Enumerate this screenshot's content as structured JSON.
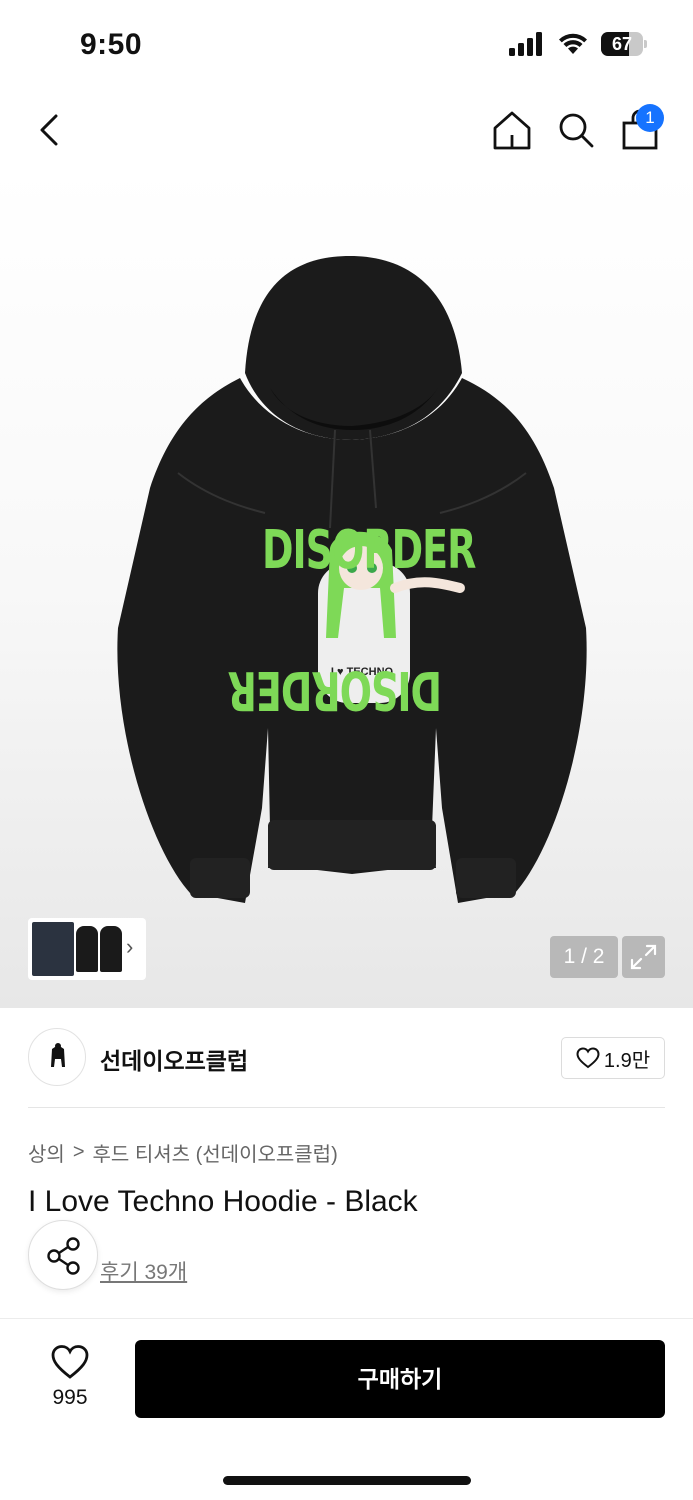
{
  "status_bar": {
    "time": "9:50",
    "battery": "67",
    "battery_level": 0.67
  },
  "nav": {
    "cart_count": "1"
  },
  "gallery": {
    "pager": "1 / 2",
    "hoodie_print_text": "DISORDER",
    "hoodie_print_small": "I ♥ TECHNO"
  },
  "brand": {
    "name": "선데이오프클럽",
    "likes": "1.9만"
  },
  "breadcrumb": {
    "level1": "상의",
    "separator": ">",
    "level2": "후드 티셔츠 (선데이오프클럽)"
  },
  "product": {
    "title": "I Love Techno Hoodie - Black",
    "reviews": "후기 39개"
  },
  "bottom_bar": {
    "wish_count": "995",
    "buy_label": "구매하기"
  },
  "colors": {
    "accent_badge": "#1673ff",
    "print_green": "#7ed957",
    "hoodie": "#1b1b1b"
  }
}
